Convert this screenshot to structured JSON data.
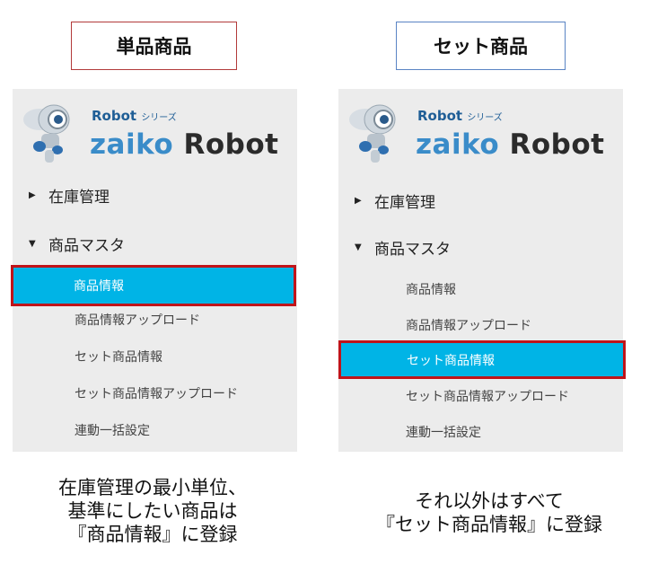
{
  "left": {
    "title": "単品商品",
    "logo": {
      "series": "Robot",
      "series_suffix": "シリーズ",
      "brand_a": "zaiko",
      "brand_b": "Robot"
    },
    "nav": {
      "inventory": "在庫管理",
      "master": "商品マスタ"
    },
    "items": [
      "商品情報",
      "商品情報アップロード",
      "セット商品情報",
      "セット商品情報アップロード",
      "連動一括設定"
    ],
    "selected_index": 0,
    "caption": [
      "在庫管理の最小単位、",
      "基準にしたい商品は",
      "『商品情報』に登録"
    ]
  },
  "right": {
    "title": "セット商品",
    "logo": {
      "series": "Robot",
      "series_suffix": "シリーズ",
      "brand_a": "zaiko",
      "brand_b": "Robot"
    },
    "nav": {
      "inventory": "在庫管理",
      "master": "商品マスタ"
    },
    "items": [
      "商品情報",
      "商品情報アップロード",
      "セット商品情報",
      "セット商品情報アップロード",
      "連動一括設定"
    ],
    "selected_index": 2,
    "caption": [
      "それ以外はすべて",
      "『セット商品情報』に登録"
    ]
  },
  "colors": {
    "selected_bg": "#00b4e6",
    "selected_border": "#c0141a",
    "brand_blue": "#3a8cc9"
  }
}
